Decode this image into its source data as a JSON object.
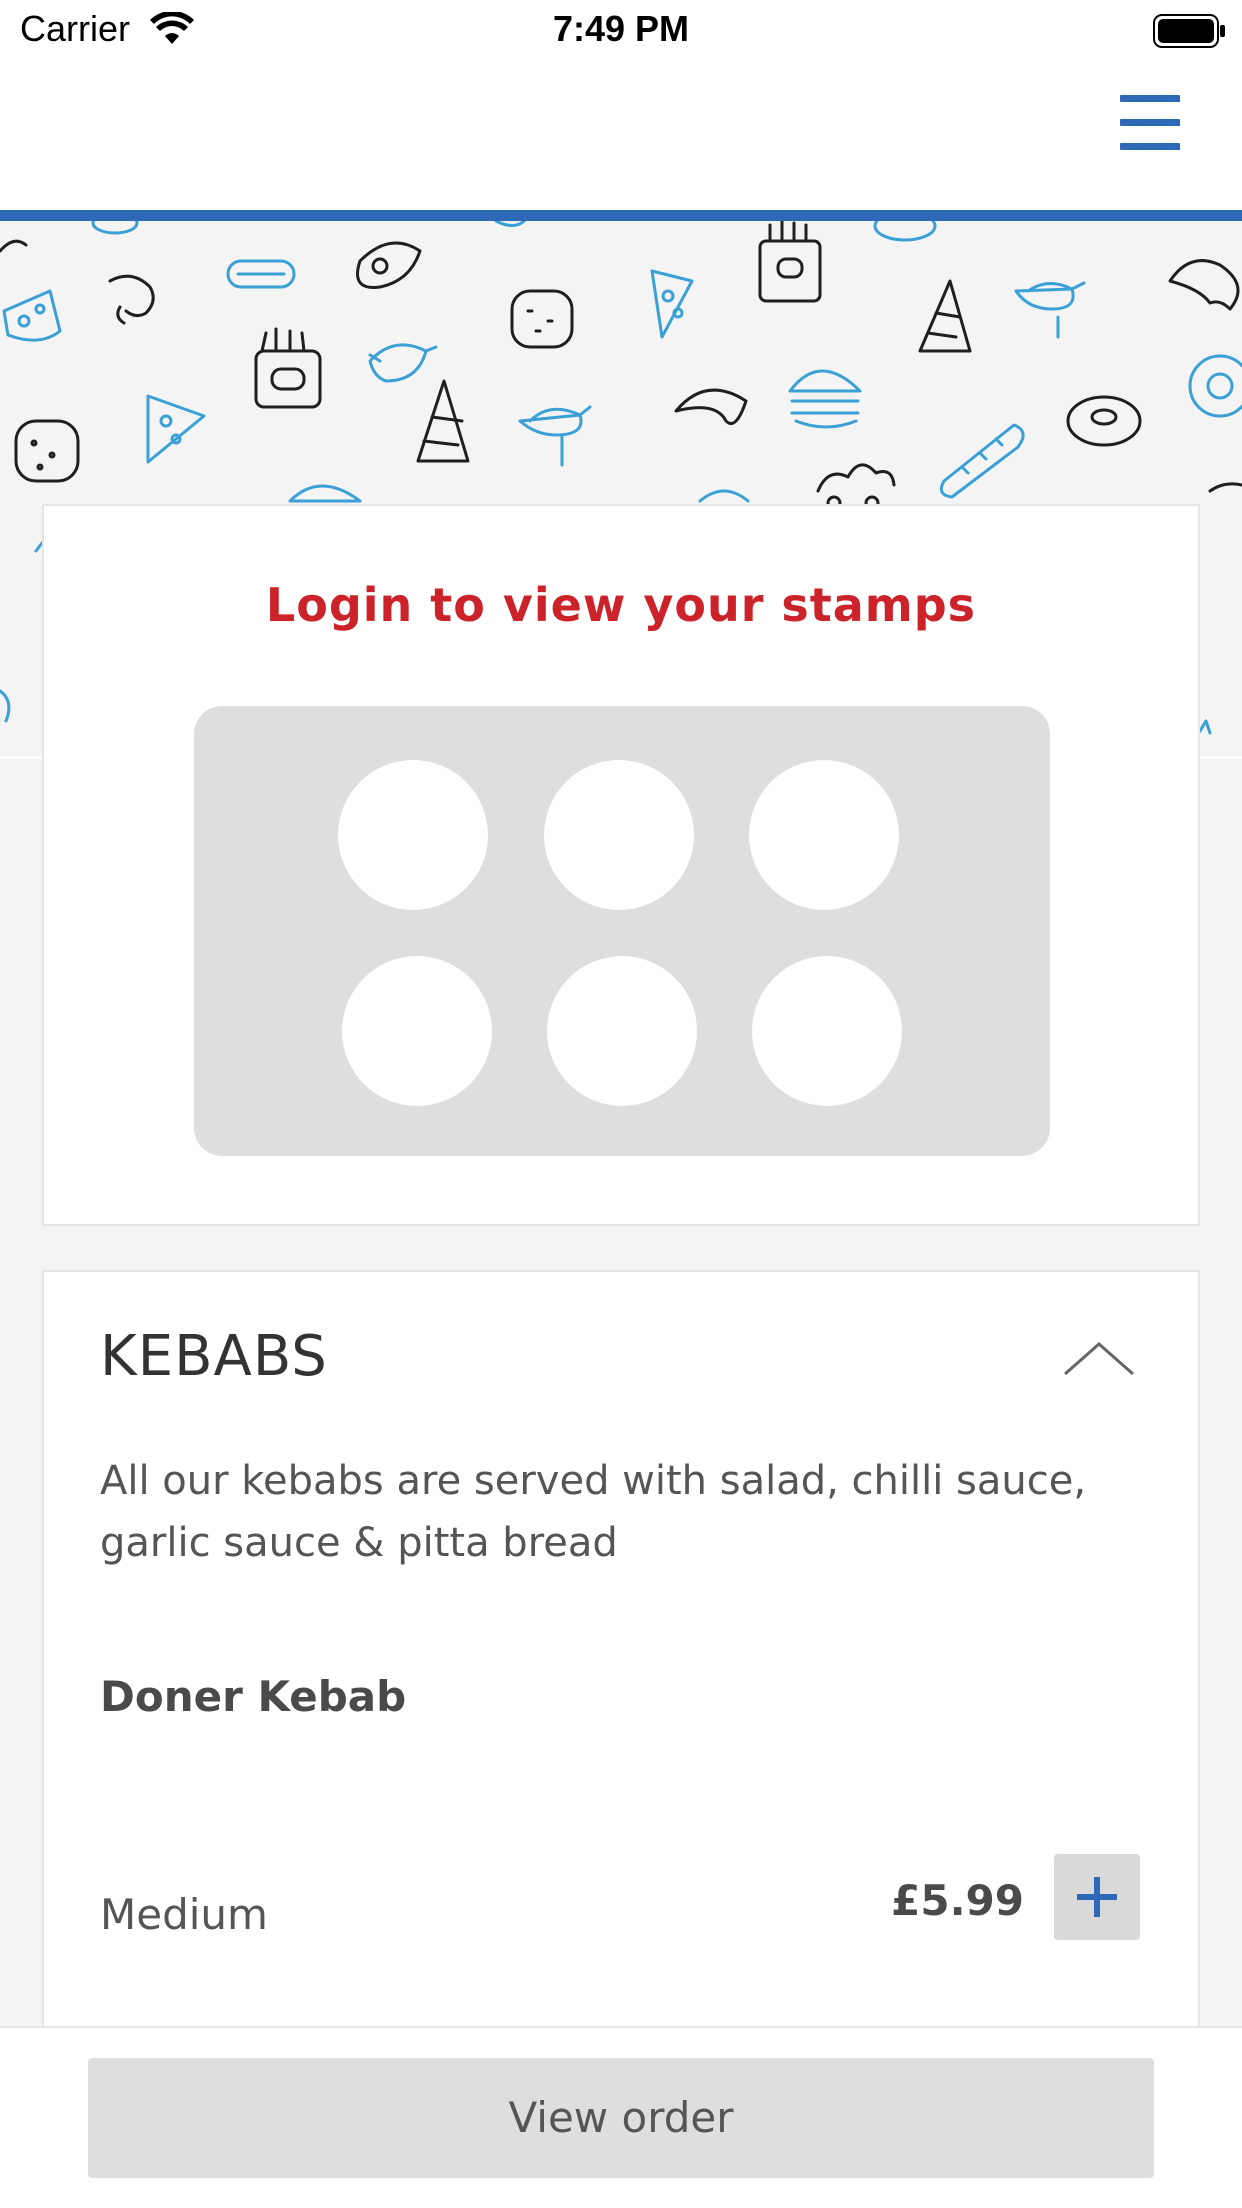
{
  "status_bar": {
    "carrier": "Carrier",
    "time": "7:49 PM",
    "wifi_icon": "wifi-icon",
    "battery_icon": "battery-full-icon"
  },
  "nav": {
    "menu_icon": "hamburger-menu-icon"
  },
  "colors": {
    "accent_blue": "#2e69b8",
    "title_red": "#cc2229",
    "doodle_blue": "#3aa0d6",
    "doodle_black": "#1f1f1f"
  },
  "stamps": {
    "title": "Login to view your stamps",
    "total": 6,
    "collected": 0
  },
  "category": {
    "title": "KEBABS",
    "description": "All our kebabs are served with salad, chilli sauce, garlic sauce & pitta bread",
    "collapse_icon": "chevron-up-icon",
    "items": [
      {
        "name": "Doner Kebab",
        "variants": [
          {
            "size": "Medium",
            "price": "£5.99",
            "add_icon": "plus-icon"
          }
        ]
      }
    ]
  },
  "footer": {
    "view_order_label": "View order"
  }
}
